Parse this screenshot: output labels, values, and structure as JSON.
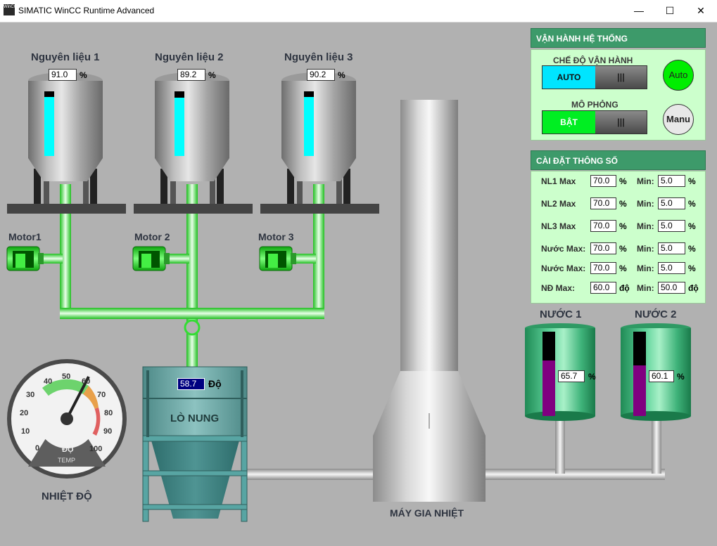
{
  "window": {
    "title": "SIMATIC WinCC Runtime Advanced",
    "icon_text": "WinCC",
    "controls": {
      "minimize": "—",
      "maximize": "☐",
      "close": "✕"
    }
  },
  "tanks": [
    {
      "title": "Nguyên liệu 1",
      "value": "91.0",
      "unit": "%",
      "level": 0.91
    },
    {
      "title": "Nguyên liệu 2",
      "value": "89.2",
      "unit": "%",
      "level": 0.892
    },
    {
      "title": "Nguyên liệu 3",
      "value": "90.2",
      "unit": "%",
      "level": 0.902
    }
  ],
  "motors": [
    "Motor1",
    "Motor 2",
    "Motor 3"
  ],
  "furnace": {
    "value": "58.7",
    "unit": "Độ",
    "label": "LÒ NUNG"
  },
  "gauge": {
    "label": "NHIỆT ĐỘ",
    "face_text_1": "ĐỘ",
    "face_text_2": "TEMP",
    "ticks": [
      "0",
      "10",
      "20",
      "30",
      "40",
      "50",
      "60",
      "70",
      "80",
      "90",
      "100"
    ],
    "value": 58.7
  },
  "heater": {
    "label": "MÁY GIA NHIỆT"
  },
  "water": [
    {
      "title": "NƯỚC 1",
      "value": "65.7",
      "unit": "%",
      "level": 0.657
    },
    {
      "title": "NƯỚC 2",
      "value": "60.1",
      "unit": "%",
      "level": 0.601
    }
  ],
  "system": {
    "header": "VẬN HÀNH HỆ THỐNG",
    "mode_label": "CHẾ ĐỘ VẬN HÀNH",
    "mode_value": "AUTO",
    "sim_label": "MÔ PHỎNG",
    "sim_value": "BẬT",
    "toggle_grip": "|||",
    "auto_button": "Auto",
    "manu_button": "Manu"
  },
  "settings": {
    "header": "CÀI ĐẶT THÔNG SỐ",
    "rows": [
      {
        "label": "NL1 Max",
        "max": "70.0",
        "max_unit": "%",
        "min_label": "Min:",
        "min": "5.0",
        "min_unit": "%"
      },
      {
        "label": "NL2 Max",
        "max": "70.0",
        "max_unit": "%",
        "min_label": "Min:",
        "min": "5.0",
        "min_unit": "%"
      },
      {
        "label": "NL3 Max",
        "max": "70.0",
        "max_unit": "%",
        "min_label": "Min:",
        "min": "5.0",
        "min_unit": "%"
      },
      {
        "label": "Nước Max:",
        "max": "70.0",
        "max_unit": "%",
        "min_label": "Min:",
        "min": "5.0",
        "min_unit": "%"
      },
      {
        "label": "Nước Max:",
        "max": "70.0",
        "max_unit": "%",
        "min_label": "Min:",
        "min": "5.0",
        "min_unit": "%"
      },
      {
        "label": "NĐ Max:",
        "max": "60.0",
        "max_unit": "độ",
        "min_label": "Min:",
        "min": "50.0",
        "min_unit": "độ"
      }
    ]
  },
  "colors": {
    "pipe_green": "#33ff33",
    "level_cyan": "#00ffff",
    "water_level": "#800080",
    "panel_header": "#3d9a6a",
    "panel_body": "#ccffcc",
    "auto_lamp": "#00ee00"
  }
}
